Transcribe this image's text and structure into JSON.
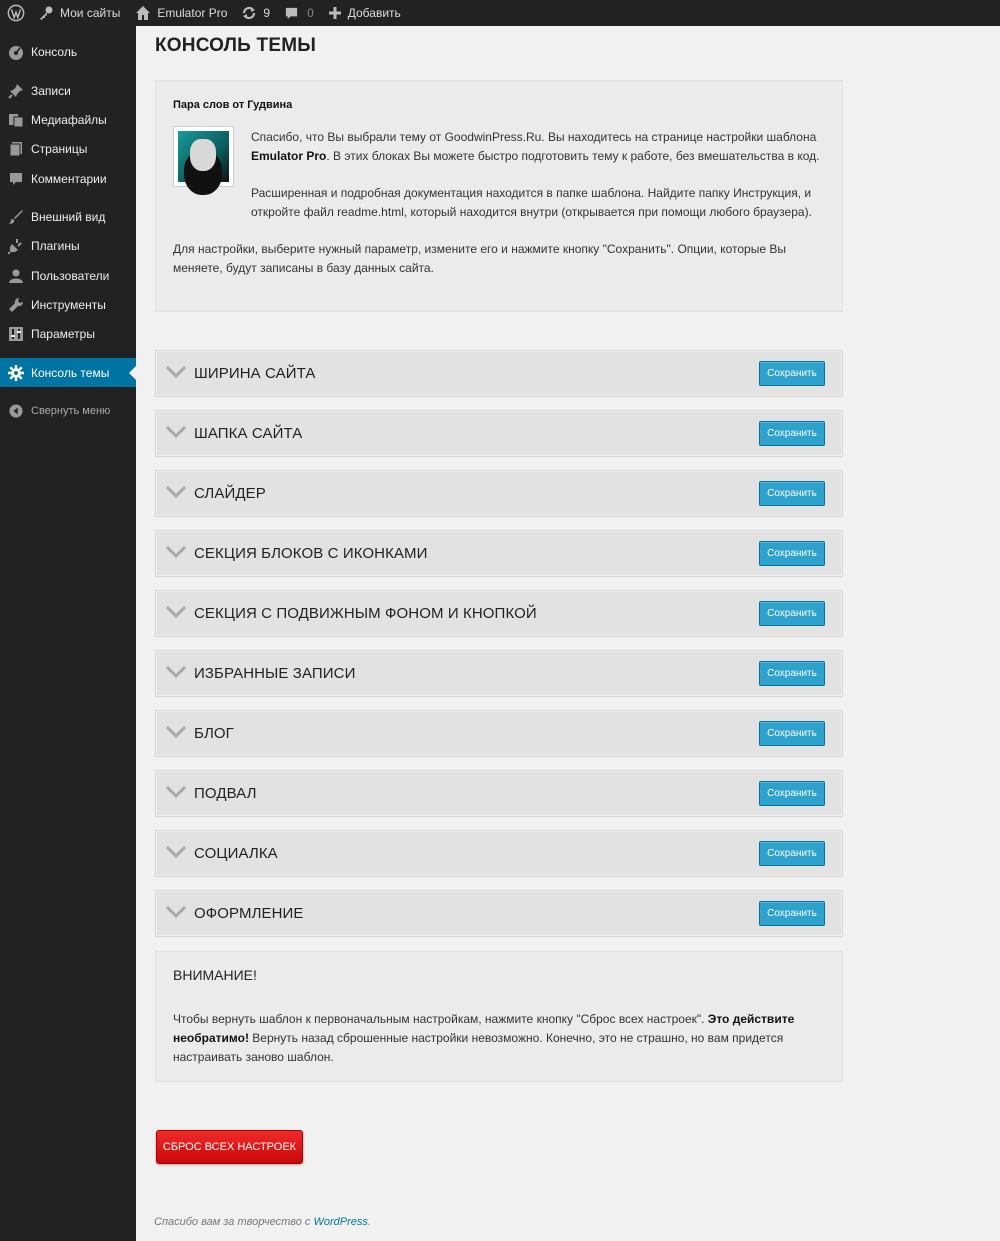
{
  "adminbar": {
    "my_sites": "Мои сайты",
    "site_name": "Emulator Pro",
    "updates_count": "9",
    "comments_count": "0",
    "add_new": "Добавить"
  },
  "sidebar": {
    "items": [
      {
        "label": "Консоль",
        "icon": "dashboard-icon"
      },
      {
        "label": "Записи",
        "icon": "pin-icon"
      },
      {
        "label": "Медиафайлы",
        "icon": "media-icon"
      },
      {
        "label": "Страницы",
        "icon": "pages-icon"
      },
      {
        "label": "Комментарии",
        "icon": "comment-icon"
      },
      {
        "label": "Внешний вид",
        "icon": "appearance-icon"
      },
      {
        "label": "Плагины",
        "icon": "plugin-icon"
      },
      {
        "label": "Пользователи",
        "icon": "users-icon"
      },
      {
        "label": "Инструменты",
        "icon": "tools-icon"
      },
      {
        "label": "Параметры",
        "icon": "settings-icon"
      },
      {
        "label": "Консоль темы",
        "icon": "gear-icon"
      },
      {
        "label": "Свернуть меню",
        "icon": "collapse-icon"
      }
    ],
    "active_color": "#0074a2"
  },
  "page": {
    "title": "КОНСОЛЬ ТЕМЫ",
    "intro_heading": "Пара слов от Гудвина",
    "intro_p1_a": "Спасибо, что Вы выбрали тему от GoodwinPress.Ru. Вы находитесь на странице настройки шаблона ",
    "intro_p1_bold": "Emulator Pro",
    "intro_p1_b": ". В этих блоках Вы можете быстро подготовить тему к работе, без вмешательства в код.",
    "intro_p2": "Расширенная и подробная документация находится в папке шаблона. Найдите папку Инструкция, и откройте файл readme.html, который находится внутри (открывается при помощи любого браузера).",
    "intro_p3": "Для настройки, выберите нужный параметр, измените его и нажмите кнопку \"Сохранить\". Опции, которые Вы меняете, будут записаны в базу данных сайта."
  },
  "sections": [
    {
      "title": "ШИРИНА САЙТА",
      "button": "Сохранить"
    },
    {
      "title": "ШАПКА САЙТА",
      "button": "Сохранить"
    },
    {
      "title": "СЛАЙДЕР",
      "button": "Сохранить"
    },
    {
      "title": "СЕКЦИЯ БЛОКОВ С ИКОНКАМИ",
      "button": "Сохранить"
    },
    {
      "title": "СЕКЦИЯ С ПОДВИЖНЫМ ФОНОМ И КНОПКОЙ",
      "button": "Сохранить"
    },
    {
      "title": "ИЗБРАННЫЕ ЗАПИСИ",
      "button": "Сохранить"
    },
    {
      "title": "БЛОГ",
      "button": "Сохранить"
    },
    {
      "title": "ПОДВАЛ",
      "button": "Сохранить"
    },
    {
      "title": "СОЦИАЛКА",
      "button": "Сохранить"
    },
    {
      "title": "ОФОРМЛЕНИЕ",
      "button": "Сохранить"
    }
  ],
  "warning": {
    "title": "ВНИМАНИЕ!",
    "text_a": "Чтобы вернуть шаблон к первоначальным настройкам, нажмите кнопку \"Сброс всех настроек\". ",
    "text_bold": "Это действите необратимо!",
    "text_b": " Вернуть назад сброшенные настройки невозможно. Конечно, это не страшно, но вам придется настраивать заново шаблон."
  },
  "reset_button": "СБРОС ВСЕХ НАСТРОЕК",
  "footer": {
    "text": "Спасибо вам за творчество с ",
    "link": "WordPress",
    "dot": "."
  },
  "colors": {
    "save_button": "#2ea2cc",
    "reset_button": "#e01010",
    "adminbar": "#222222"
  }
}
